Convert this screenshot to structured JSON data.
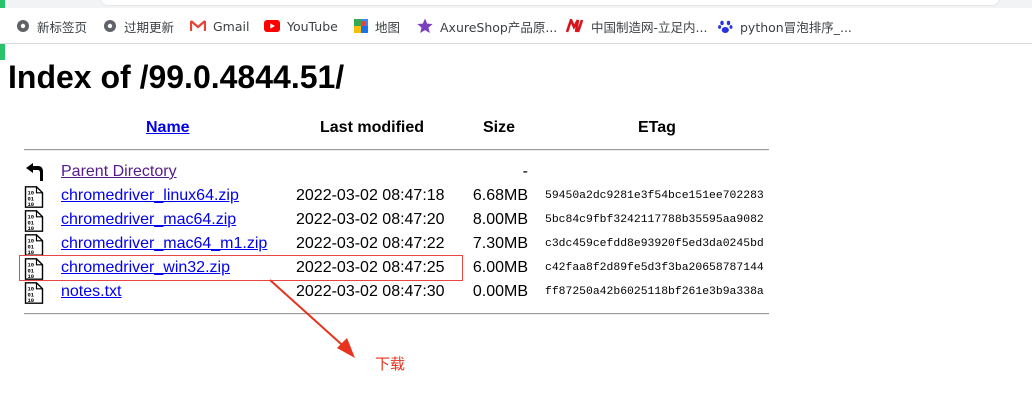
{
  "bookmarks": [
    {
      "label": "新标签页",
      "icon": "globe-icon"
    },
    {
      "label": "过期更新",
      "icon": "globe-icon"
    },
    {
      "label": "Gmail",
      "icon": "gmail-icon"
    },
    {
      "label": "YouTube",
      "icon": "youtube-icon"
    },
    {
      "label": "地图",
      "icon": "maps-icon"
    },
    {
      "label": "AxureShop产品原...",
      "icon": "axureshop-icon"
    },
    {
      "label": "中国制造网-立足内...",
      "icon": "made-in-china-icon"
    },
    {
      "label": "python冒泡排序_...",
      "icon": "baidu-paw-icon"
    }
  ],
  "page": {
    "title": "Index of /99.0.4844.51/",
    "headers": {
      "name": "Name",
      "modified": "Last modified",
      "size": "Size",
      "etag": "ETag"
    },
    "rows": [
      {
        "name": "Parent Directory",
        "modified": "",
        "size": "-",
        "etag": "",
        "icon": "back-arrow-icon"
      },
      {
        "name": "chromedriver_linux64.zip",
        "modified": "2022-03-02 08:47:18",
        "size": "6.68MB",
        "etag": "59450a2dc9281e3f54bce151ee702283",
        "icon": "binary-file-icon"
      },
      {
        "name": "chromedriver_mac64.zip",
        "modified": "2022-03-02 08:47:20",
        "size": "8.00MB",
        "etag": "5bc84c9fbf3242117788b35595aa9082",
        "icon": "binary-file-icon"
      },
      {
        "name": "chromedriver_mac64_m1.zip",
        "modified": "2022-03-02 08:47:22",
        "size": "7.30MB",
        "etag": "c3dc459cefdd8e93920f5ed3da0245bd",
        "icon": "binary-file-icon"
      },
      {
        "name": "chromedriver_win32.zip",
        "modified": "2022-03-02 08:47:25",
        "size": "6.00MB",
        "etag": "c42faa8f2d89fe5d3f3ba20658787144",
        "icon": "binary-file-icon"
      },
      {
        "name": "notes.txt",
        "modified": "2022-03-02 08:47:30",
        "size": "0.00MB",
        "etag": "ff87250a42b6025118bf261e3b9a338a",
        "icon": "binary-file-icon"
      }
    ]
  },
  "annotation": {
    "label": "下载",
    "color": "#e8331f",
    "highlighted_row": "chromedriver_win32.zip"
  }
}
